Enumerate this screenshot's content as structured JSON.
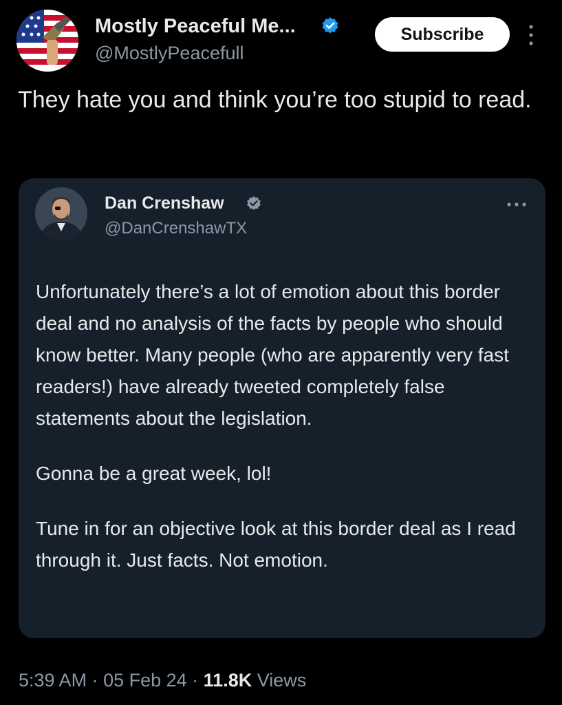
{
  "author": {
    "display_name": "Mostly Peaceful Me...",
    "handle": "@MostlyPeacefull",
    "avatar_icon": "flag-avatar-icon",
    "verified_icon": "verified-badge-icon",
    "verified_color": "#1d9bf0"
  },
  "actions": {
    "subscribe_label": "Subscribe",
    "more_icon": "more-vertical-icon"
  },
  "tweet": {
    "text": "They hate you and think you’re too stupid to read."
  },
  "quoted_tweet": {
    "display_name": "Dan Crenshaw",
    "handle": "@DanCrenshawTX",
    "verified_icon": "verified-badge-icon",
    "verified_color": "#8b98a5",
    "more_icon": "more-horizontal-icon",
    "paragraphs": [
      "Unfortunately there’s a lot of emotion about this border deal and no analysis of the facts by people who should know better. Many people (who are apparently very fast readers!) have already tweeted completely false statements about the legislation.",
      "Gonna be a great week, lol!",
      "Tune in for an objective look at this border deal as I read through it. Just facts. Not emotion."
    ]
  },
  "meta": {
    "time": "5:39 AM",
    "separator": " · ",
    "date": "05 Feb 24",
    "views_count": "11.8K",
    "views_label": " Views"
  },
  "colors": {
    "background": "#000000",
    "card": "#15202b",
    "text": "#e7e9ea",
    "secondary": "#8b98a5"
  }
}
